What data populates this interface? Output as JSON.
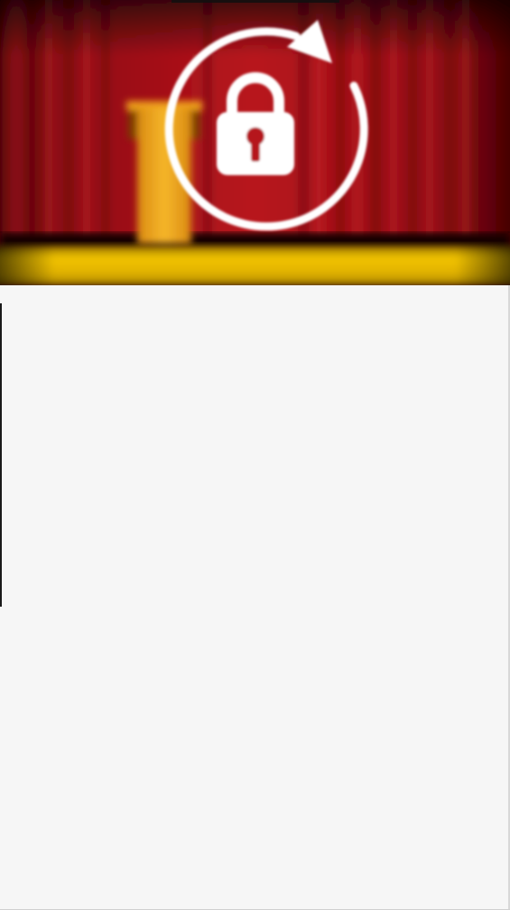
{
  "hero": {
    "scene": "stage-curtain-podium",
    "icon": "lock-rotate-icon",
    "colors": {
      "curtain": "#a5121a",
      "curtain_dark": "#4a0000",
      "stage_floor": "#e8b900",
      "podium": "#f2a920",
      "icon_fill": "#ffffff"
    }
  },
  "content": {
    "background": "#f6f6f6"
  }
}
